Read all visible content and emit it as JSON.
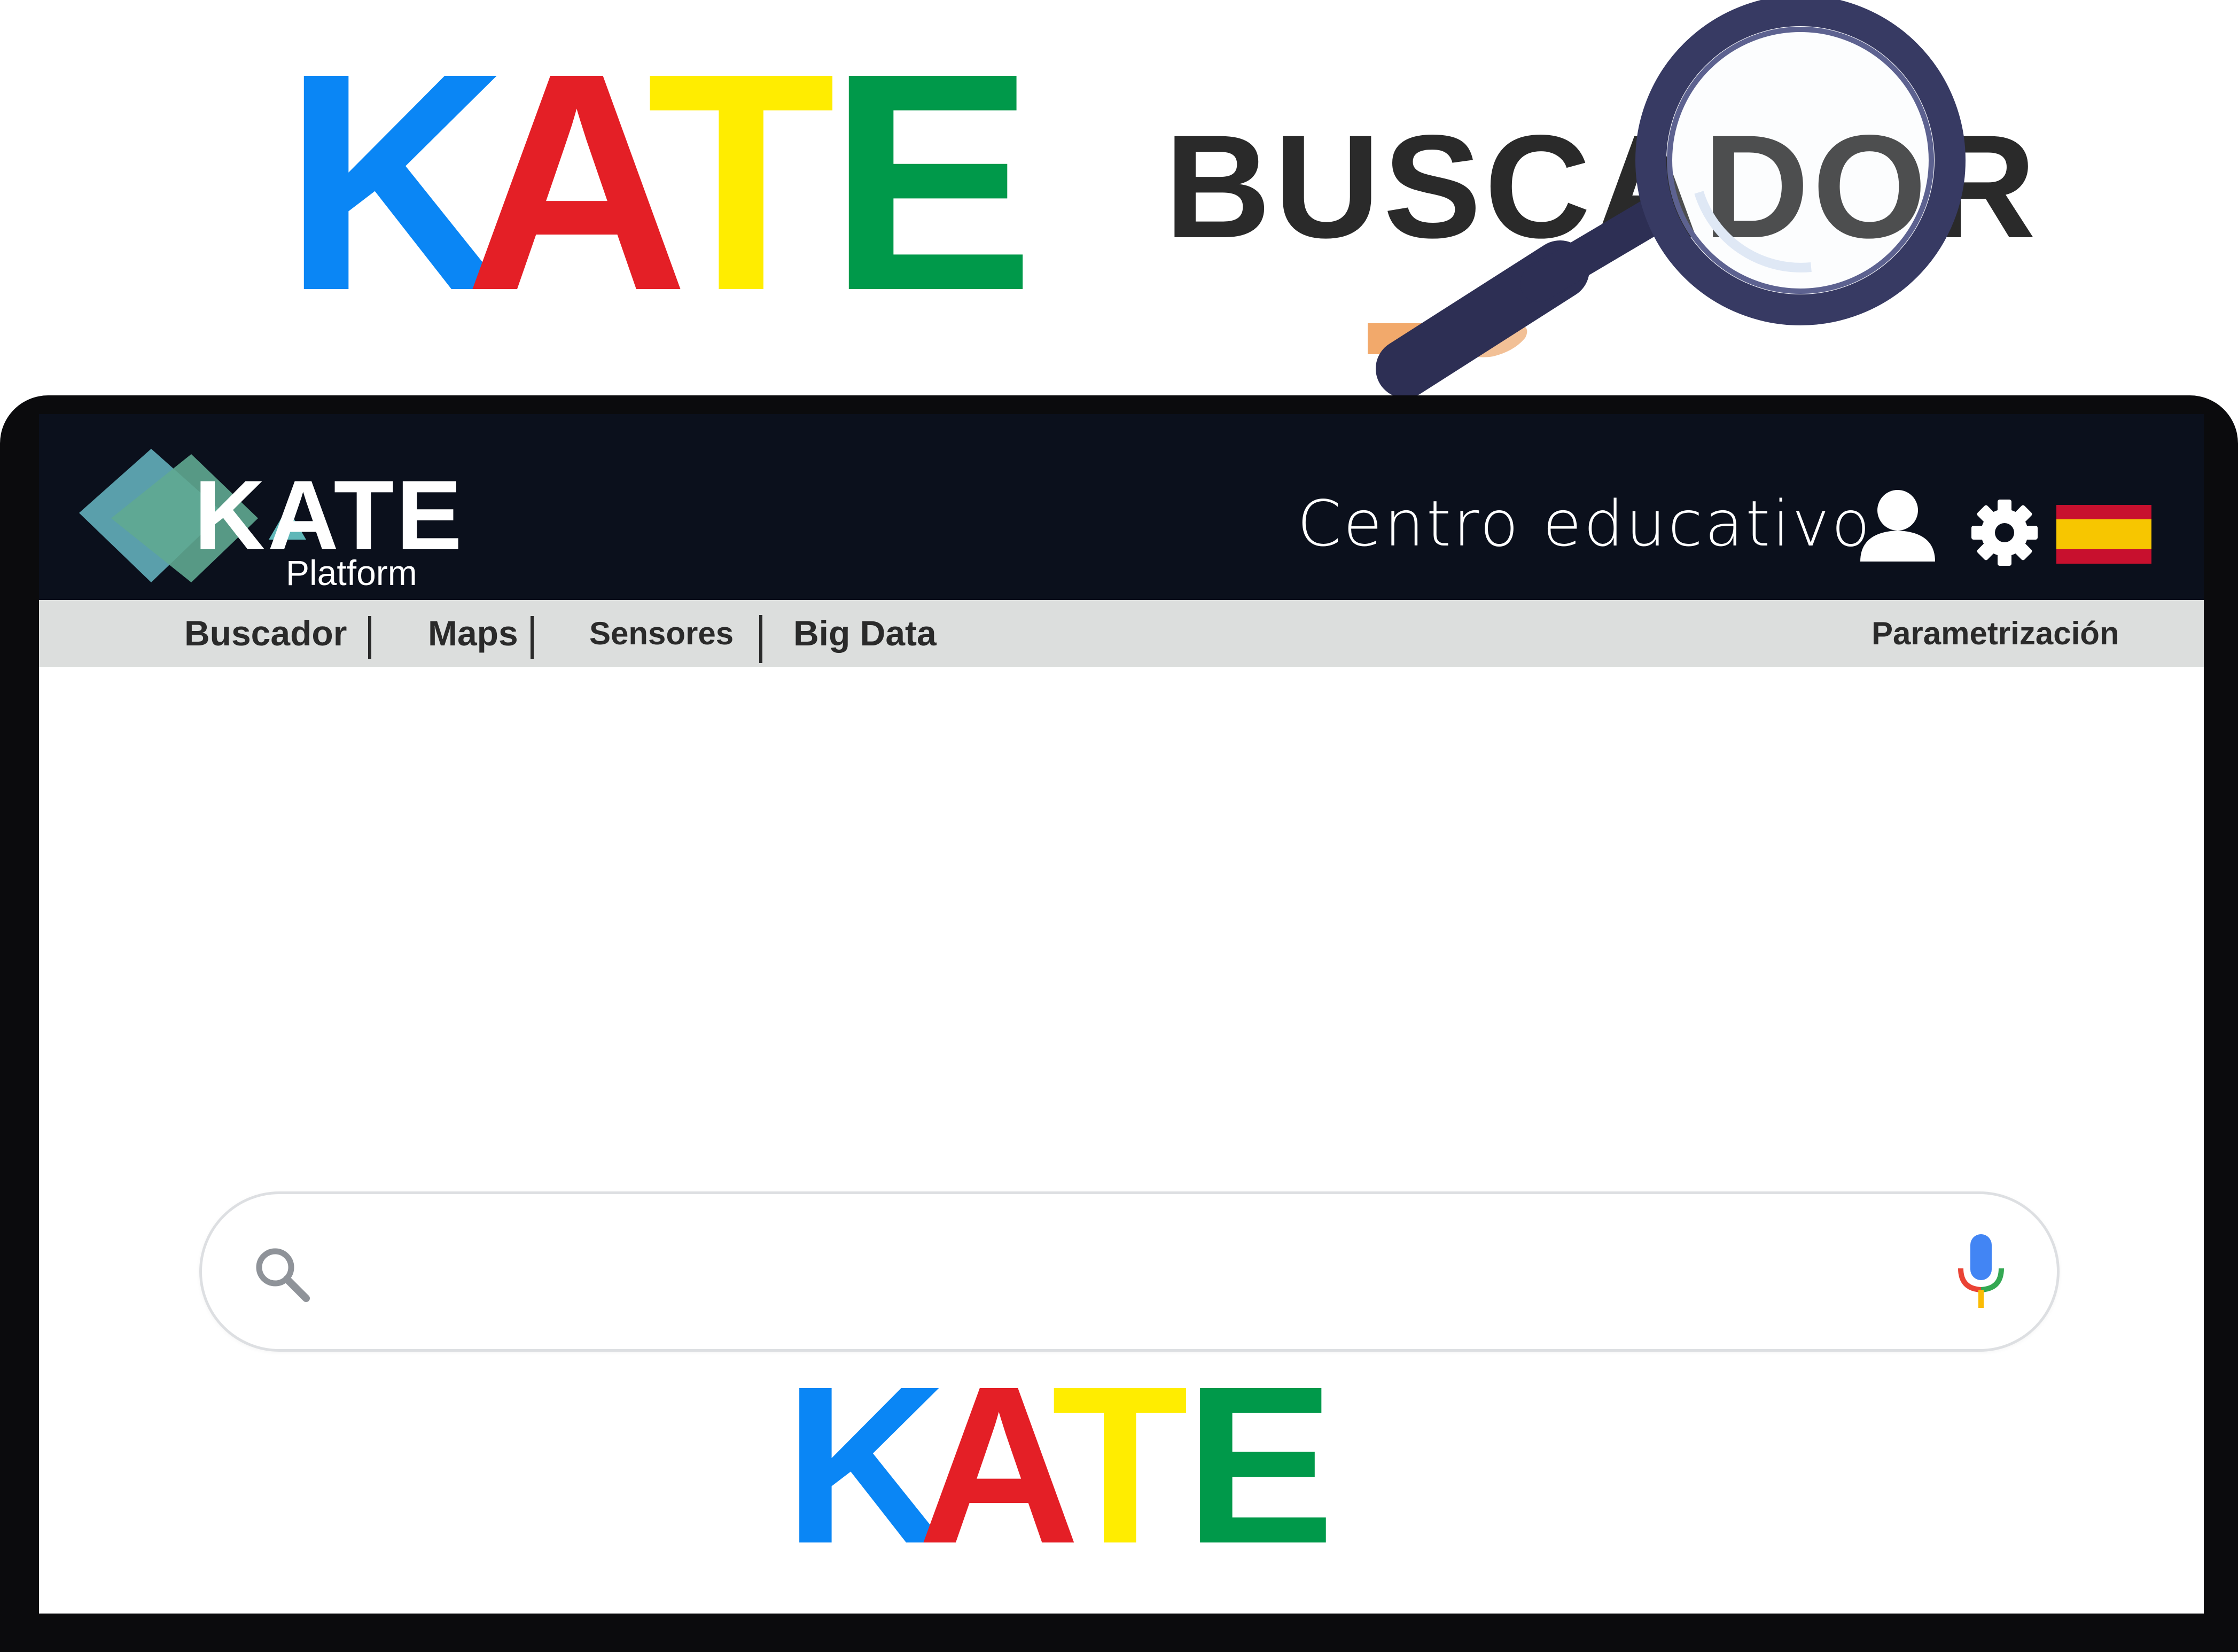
{
  "hero": {
    "kate_letters": [
      "K",
      "A",
      "T",
      "E"
    ],
    "kate_colors": [
      "#0a86f5",
      "#e41f26",
      "#ffed00",
      "#00994a"
    ],
    "title": "BUSCADOR"
  },
  "header": {
    "logo_text": "KATE",
    "logo_subtitle": "Platform",
    "center_name": "Centro educativo",
    "user_icon": "user-icon",
    "settings_icon": "gear-icon",
    "language_icon": "spain-flag-icon",
    "brand_teal": "#5aa8a8"
  },
  "nav": {
    "items": [
      "Buscador",
      "Maps",
      "Sensores",
      "Big Data"
    ],
    "right_item": "Parametrización"
  },
  "main": {
    "kate_letters": [
      "K",
      "A",
      "T",
      "E"
    ],
    "search": {
      "value": "",
      "placeholder": "",
      "search_icon": "search-icon",
      "voice_icon": "microphone-icon"
    }
  }
}
